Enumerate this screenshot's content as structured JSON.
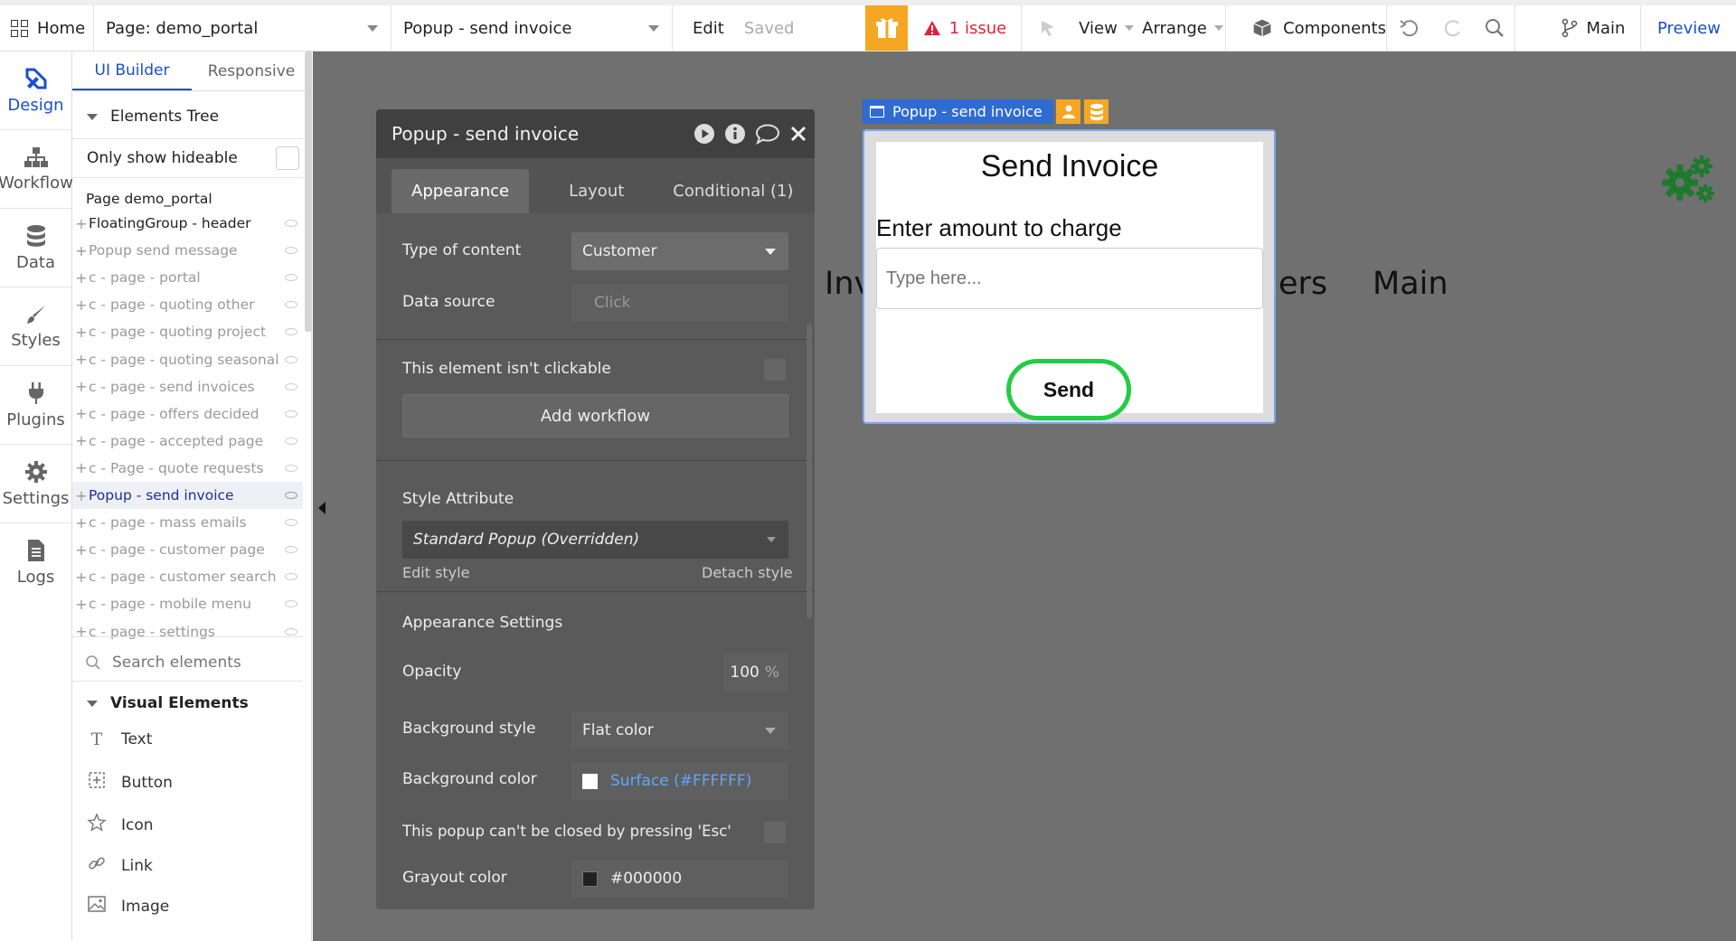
{
  "topbar": {
    "home": "Home",
    "page_select": "Page: demo_portal",
    "element_select": "Popup - send invoice",
    "edit": "Edit",
    "saved": "Saved",
    "issues": "1 issue",
    "view": "View",
    "arrange": "Arrange",
    "components": "Components",
    "branch": "Main",
    "preview": "Preview"
  },
  "leftnav": {
    "items": [
      {
        "label": "Design",
        "icon": "design-icon"
      },
      {
        "label": "Workflow",
        "icon": "workflow-icon"
      },
      {
        "label": "Data",
        "icon": "database-icon"
      },
      {
        "label": "Styles",
        "icon": "brush-icon"
      },
      {
        "label": "Plugins",
        "icon": "plug-icon"
      },
      {
        "label": "Settings",
        "icon": "gear-icon"
      },
      {
        "label": "Logs",
        "icon": "document-icon"
      }
    ]
  },
  "tree_panel": {
    "tabs": [
      "UI Builder",
      "Responsive"
    ],
    "section_title": "Elements Tree",
    "only_hideable": "Only show hideable",
    "page_root": "Page demo_portal",
    "items": [
      "FloatingGroup - header",
      "Popup send message",
      "c - page - portal",
      "c - page - quoting other",
      "c - page - quoting project",
      "c - page - quoting seasonal",
      "c - page - send invoices",
      "c - page - offers decided",
      "c - page - accepted page",
      "c - Page - quote requests",
      "Popup - send invoice",
      "c - page - mass emails",
      "c - page - customer page",
      "c - page - customer search",
      "c - page - mobile menu",
      "c - page - settings"
    ],
    "selected_index": 10,
    "search_placeholder": "Search elements",
    "visual_title": "Visual Elements",
    "visual_items": [
      "Text",
      "Button",
      "Icon",
      "Link",
      "Image"
    ]
  },
  "property_editor": {
    "title": "Popup - send invoice",
    "tabs": [
      "Appearance",
      "Layout",
      "Conditional (1)"
    ],
    "type_of_content_label": "Type of content",
    "type_of_content_value": "Customer",
    "data_source_label": "Data source",
    "data_source_value": "Click",
    "not_clickable_label": "This element isn't clickable",
    "add_workflow": "Add workflow",
    "style_attribute_label": "Style Attribute",
    "style_value": "Standard Popup (Overridden)",
    "edit_style": "Edit style",
    "detach_style": "Detach style",
    "appearance_settings": "Appearance Settings",
    "opacity_label": "Opacity",
    "opacity_value": "100",
    "opacity_unit": "%",
    "bg_style_label": "Background style",
    "bg_style_value": "Flat color",
    "bg_color_label": "Background color",
    "bg_color_value": "Surface (#FFFFFF)",
    "esc_label": "This popup can't be closed by pressing 'Esc'",
    "grayout_label": "Grayout color",
    "grayout_value": "#000000"
  },
  "canvas": {
    "popup_tag": "Popup - send invoice",
    "popup_title": "Send Invoice",
    "amount_label": "Enter amount to charge",
    "input_placeholder": "Type here...",
    "send_button": "Send",
    "bg_text_left": "Inv",
    "bg_text_mid": "ers",
    "bg_text_right": "Main"
  },
  "colors": {
    "accent": "#1a4fcf",
    "issue_red": "#e0223a",
    "gift_orange": "#f5a623",
    "send_border": "#22cc44",
    "gear_green": "#1e7a2e"
  }
}
